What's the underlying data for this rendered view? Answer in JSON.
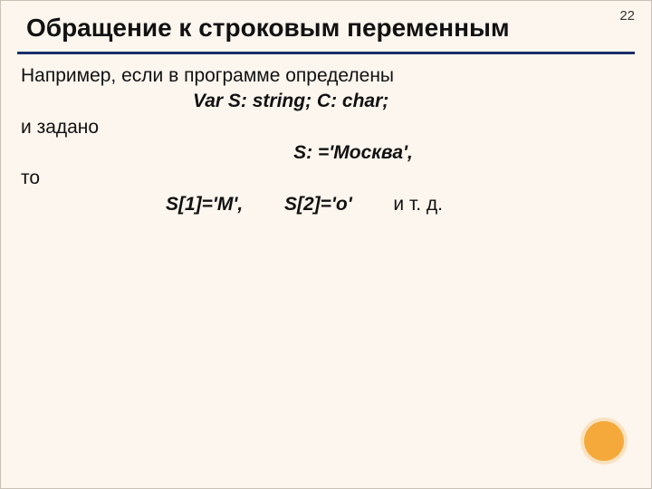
{
  "pageNumber": "22",
  "title": "Обращение к строковым переменным",
  "lines": {
    "l1": "Например,  если в программе определены",
    "varDecl": "Var S:  string;   C: char;",
    "l2": "и задано",
    "assign": "S: ='Москва',",
    "l3": "то",
    "idx1": "S[1]='М',",
    "idx2": "S[2]='о'",
    "idxTail": "и т. д."
  }
}
